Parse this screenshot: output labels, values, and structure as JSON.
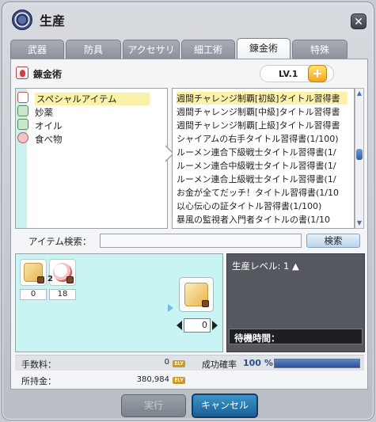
{
  "window": {
    "title": "生産"
  },
  "tabs": [
    {
      "label": "武器",
      "active": false
    },
    {
      "label": "防具",
      "active": false
    },
    {
      "label": "アクセサリー",
      "active": false
    },
    {
      "label": "細工術",
      "active": false
    },
    {
      "label": "錬金術",
      "active": true
    },
    {
      "label": "特殊",
      "active": false
    }
  ],
  "header": {
    "title": "錬金術",
    "level": "LV.1",
    "plus": "+"
  },
  "categories": [
    {
      "label": "スペシャルアイテム",
      "icon": "special-item-icon",
      "selected": true
    },
    {
      "label": "妙薬",
      "icon": "elixir-icon",
      "selected": false
    },
    {
      "label": "オイル",
      "icon": "oil-icon",
      "selected": false
    },
    {
      "label": "食べ物",
      "icon": "food-icon",
      "selected": false
    }
  ],
  "recipes": [
    "週間チャレンジ制覇[初級]タイトル習得書",
    "週間チャレンジ制覇[中級]タイトル習得書",
    "週間チャレンジ制覇[上級]タイトル習得書",
    "シャイアムの右手タイトル習得書(1/100)",
    "ルーメン連合下級戦士タイトル習得書(1/",
    "ルーメン連合中級戦士タイトル習得書(1/",
    "ルーメン連合上級戦士タイトル習得書(1/",
    "お金が全てだッチ！タイトル習得書(1/10",
    "以心伝心の証タイトル習得書(1/100)",
    "暴風の監視者入門者タイトルの書(1/10"
  ],
  "search": {
    "label": "アイテム検索：",
    "value": "",
    "button": "検索"
  },
  "materials": [
    {
      "icon": "scroll-item-icon",
      "qty_badge": "",
      "count": "0"
    },
    {
      "icon": "heart-item-icon",
      "qty_badge": "2",
      "count": "18"
    }
  ],
  "result": {
    "icon": "result-scroll-icon",
    "quantity": "0"
  },
  "info": {
    "production_level": "生産レベル: 1 ▲",
    "wait_label": "待機時間："
  },
  "fee": {
    "label": "手数料：",
    "value": "0",
    "currency": "ELY"
  },
  "success": {
    "label": "成功確率",
    "value": "100",
    "unit": "%",
    "fill": 1.0
  },
  "money": {
    "label": "所持金：",
    "value": "380,984",
    "currency": "ELY"
  },
  "buttons": {
    "execute": "実行",
    "cancel": "キャンセル"
  },
  "colors": {
    "accent": "#1b5f95",
    "highlight": "#f9f2a8",
    "material_bg": "#c9f4f4"
  }
}
